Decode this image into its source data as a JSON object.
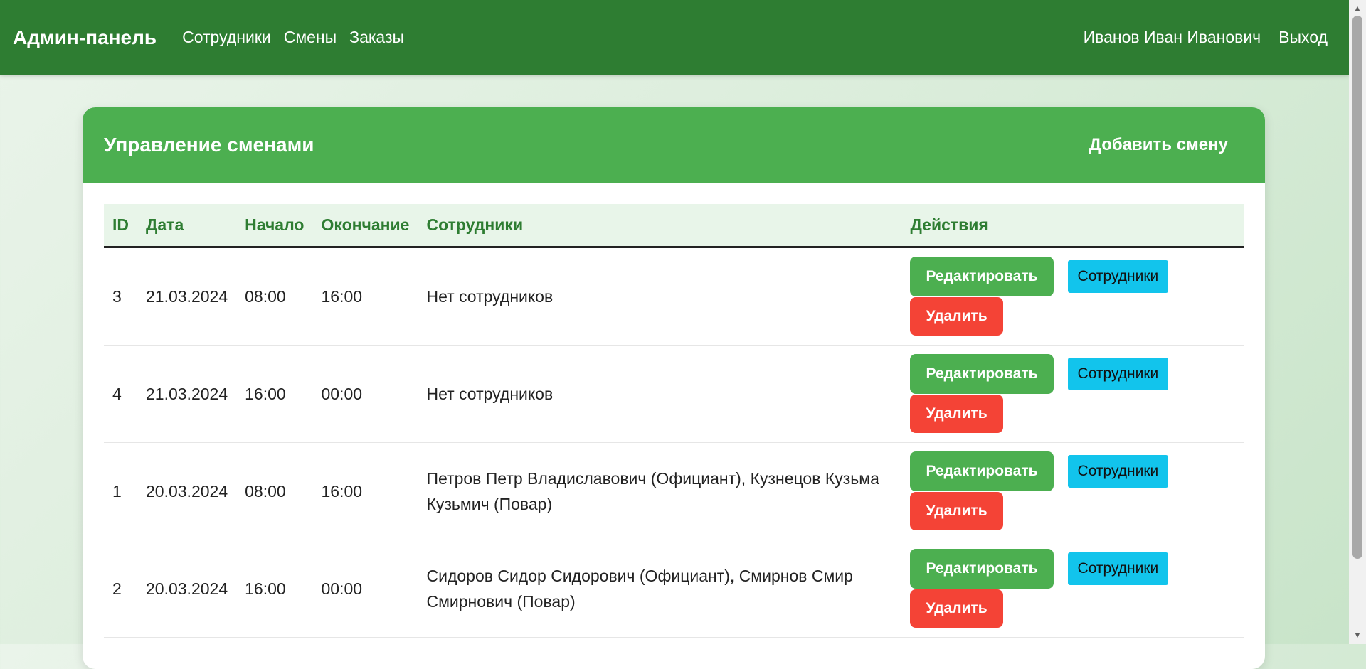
{
  "nav": {
    "brand": "Админ-панель",
    "links": [
      "Сотрудники",
      "Смены",
      "Заказы"
    ],
    "user": "Иванов Иван Иванович",
    "logout": "Выход"
  },
  "card": {
    "title": "Управление сменами",
    "add_button": "Добавить смену"
  },
  "table": {
    "headers": [
      "ID",
      "Дата",
      "Начало",
      "Окончание",
      "Сотрудники",
      "Действия"
    ],
    "rows": [
      {
        "id": "3",
        "date": "21.03.2024",
        "start": "08:00",
        "end": "16:00",
        "employees": "Нет сотрудников"
      },
      {
        "id": "4",
        "date": "21.03.2024",
        "start": "16:00",
        "end": "00:00",
        "employees": "Нет сотрудников"
      },
      {
        "id": "1",
        "date": "20.03.2024",
        "start": "08:00",
        "end": "16:00",
        "employees": "Петров Петр Владиславович (Официант), Кузнецов Кузьма Кузьмич (Повар)"
      },
      {
        "id": "2",
        "date": "20.03.2024",
        "start": "16:00",
        "end": "00:00",
        "employees": "Сидоров Сидор Сидорович (Официант), Смирнов Смир Смирнович (Повар)"
      }
    ],
    "actions": {
      "edit": "Редактировать",
      "employees": "Сотрудники",
      "delete": "Удалить"
    }
  },
  "colors": {
    "navbar": "#2e7d32",
    "header": "#4caf50",
    "edit": "#4caf50",
    "employees": "#12c4ec",
    "delete": "#f44336"
  }
}
